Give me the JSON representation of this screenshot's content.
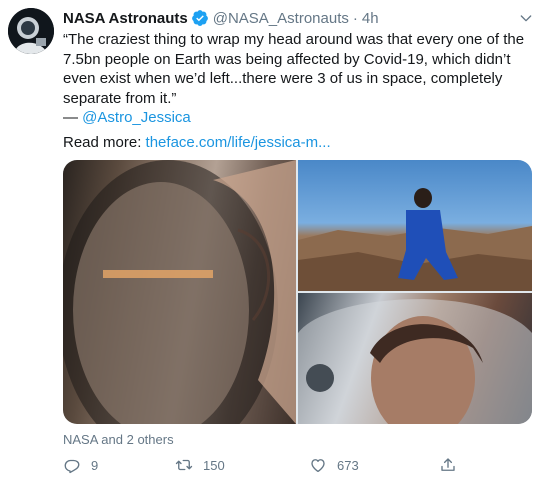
{
  "tweet": {
    "author_name": "NASA Astronauts",
    "author_handle": "@NASA_Astronauts",
    "separator": "·",
    "time": "4h",
    "text": "“The craziest thing to wrap my head around was that every one of the 7.5bn people on Earth was being affected by Covid-19, which didn’t even exist when we’d left...there were 3 of us in space, completely separate from it.”",
    "attribution_prefix": "— ",
    "attribution_mention": "@Astro_Jessica",
    "read_more_label": "Read more: ",
    "read_more_link": "theface.com/life/jessica-m...",
    "likers": "NASA and 2 others",
    "reply_count": "9",
    "retweet_count": "150",
    "like_count": "673"
  },
  "icons": {
    "verified": "verified-badge-icon",
    "caret": "chevron-down-icon",
    "reply": "reply-icon",
    "retweet": "retweet-icon",
    "like": "heart-icon",
    "share": "share-icon"
  },
  "colors": {
    "link": "#1b95e0",
    "muted": "#657786",
    "text": "#14171a"
  }
}
